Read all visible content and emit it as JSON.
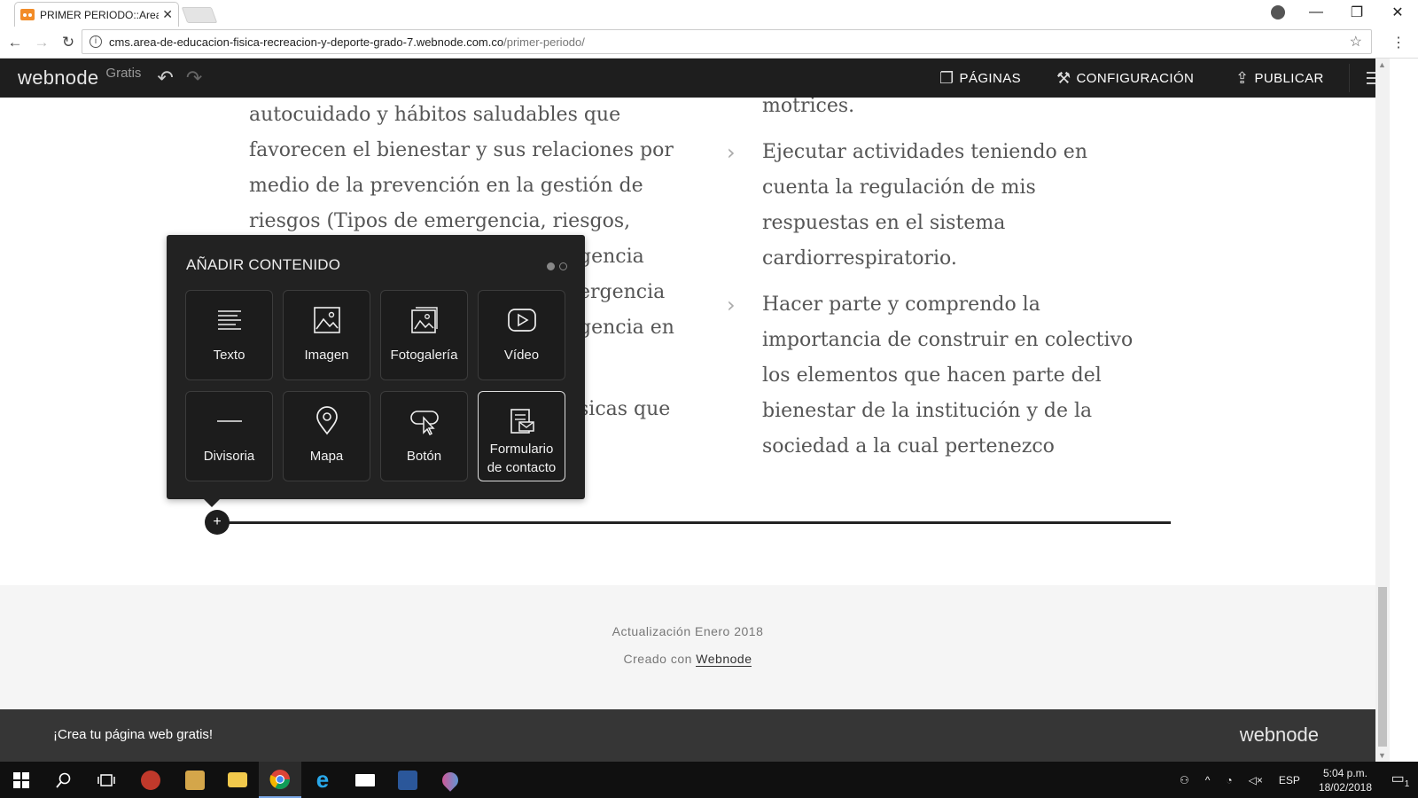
{
  "browser": {
    "tab_title": "PRIMER PERIODO::Area-d",
    "url_host": "cms.area-de-educacion-fisica-recreacion-y-deporte-grado-7.webnode.com.co",
    "url_path": "/primer-periodo/"
  },
  "editor": {
    "logo": "webnode",
    "plan": "Gratis",
    "menu": {
      "pages": "PÁGINAS",
      "settings": "CONFIGURACIÓN",
      "publish": "PUBLICAR"
    }
  },
  "content": {
    "left_p1": "autocuidado y hábitos saludables que favorecen el bienestar y sus relaciones por medio de la prevención en la gestión de riesgos (Tipos de emergencia, riesgos,",
    "left_frag1": "gencia",
    "left_frag2": "ergencia",
    "left_frag3": "gencia en",
    "left_frag4": "sicas que",
    "right_frag": "motrices.",
    "right_bullets": [
      "Ejecutar actividades teniendo en cuenta la regulación de mis respuestas en el sistema cardiorrespiratorio.",
      "Hacer parte y comprendo la importancia de construir en colectivo los elementos que hacen parte del bienestar de la institución y de la sociedad a la cual pertenezco"
    ]
  },
  "popup": {
    "title": "AÑADIR CONTENIDO",
    "tiles": [
      {
        "label": "Texto",
        "icon": "text-icon"
      },
      {
        "label": "Imagen",
        "icon": "image-icon"
      },
      {
        "label": "Fotogalería",
        "icon": "gallery-icon"
      },
      {
        "label": "Vídeo",
        "icon": "video-icon"
      },
      {
        "label": "Divisoria",
        "icon": "divider-icon"
      },
      {
        "label": "Mapa",
        "icon": "map-pin-icon"
      },
      {
        "label": "Botón",
        "icon": "button-cursor-icon"
      },
      {
        "label": "Formulario de contacto",
        "icon": "form-icon"
      }
    ]
  },
  "footer": {
    "updated": "Actualización Enero 2018",
    "created_prefix": "Creado con",
    "created_link": "Webnode",
    "promo_cta": "¡Crea tu página web gratis!",
    "promo_logo": "webnode"
  },
  "taskbar": {
    "lang": "ESP",
    "time": "5:04 p.m.",
    "date": "18/02/2018",
    "notifications": "1"
  }
}
